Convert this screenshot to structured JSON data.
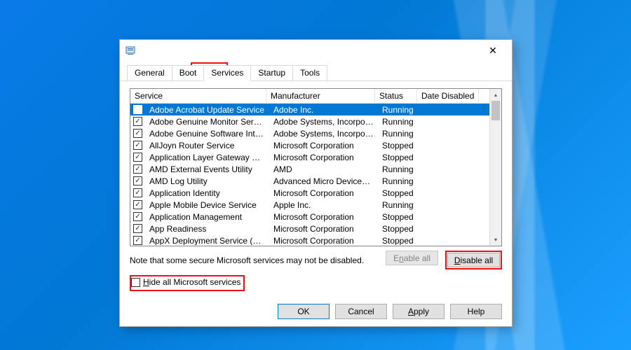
{
  "titlebar": {
    "close": "✕"
  },
  "tabs": {
    "general": "General",
    "boot": "Boot",
    "services": "Services",
    "startup": "Startup",
    "tools": "Tools"
  },
  "columns": {
    "service": "Service",
    "manufacturer": "Manufacturer",
    "status": "Status",
    "date_disabled": "Date Disabled"
  },
  "rows": [
    {
      "svc": "Adobe Acrobat Update Service",
      "mfr": "Adobe Inc.",
      "stat": "Running",
      "sel": true
    },
    {
      "svc": "Adobe Genuine Monitor Service",
      "mfr": "Adobe Systems, Incorpora...",
      "stat": "Running"
    },
    {
      "svc": "Adobe Genuine Software Integri...",
      "mfr": "Adobe Systems, Incorpora...",
      "stat": "Running"
    },
    {
      "svc": "AllJoyn Router Service",
      "mfr": "Microsoft Corporation",
      "stat": "Stopped"
    },
    {
      "svc": "Application Layer Gateway Service",
      "mfr": "Microsoft Corporation",
      "stat": "Stopped"
    },
    {
      "svc": "AMD External Events Utility",
      "mfr": "AMD",
      "stat": "Running"
    },
    {
      "svc": "AMD Log Utility",
      "mfr": "Advanced Micro Devices, I...",
      "stat": "Running"
    },
    {
      "svc": "Application Identity",
      "mfr": "Microsoft Corporation",
      "stat": "Stopped"
    },
    {
      "svc": "Apple Mobile Device Service",
      "mfr": "Apple Inc.",
      "stat": "Running"
    },
    {
      "svc": "Application Management",
      "mfr": "Microsoft Corporation",
      "stat": "Stopped"
    },
    {
      "svc": "App Readiness",
      "mfr": "Microsoft Corporation",
      "stat": "Stopped"
    },
    {
      "svc": "AppX Deployment Service (AppX...",
      "mfr": "Microsoft Corporation",
      "stat": "Stopped"
    }
  ],
  "note": "Note that some secure Microsoft services may not be disabled.",
  "buttons": {
    "enable_all_pre": "E",
    "enable_all_u": "n",
    "enable_all_post": "able all",
    "disable_all_pre": "",
    "disable_all_u": "D",
    "disable_all_post": "isable all",
    "ok": "OK",
    "cancel": "Cancel",
    "apply_pre": "",
    "apply_u": "A",
    "apply_post": "pply",
    "help": "Help"
  },
  "hide": {
    "pre": "",
    "u": "H",
    "post": "ide all Microsoft services"
  }
}
